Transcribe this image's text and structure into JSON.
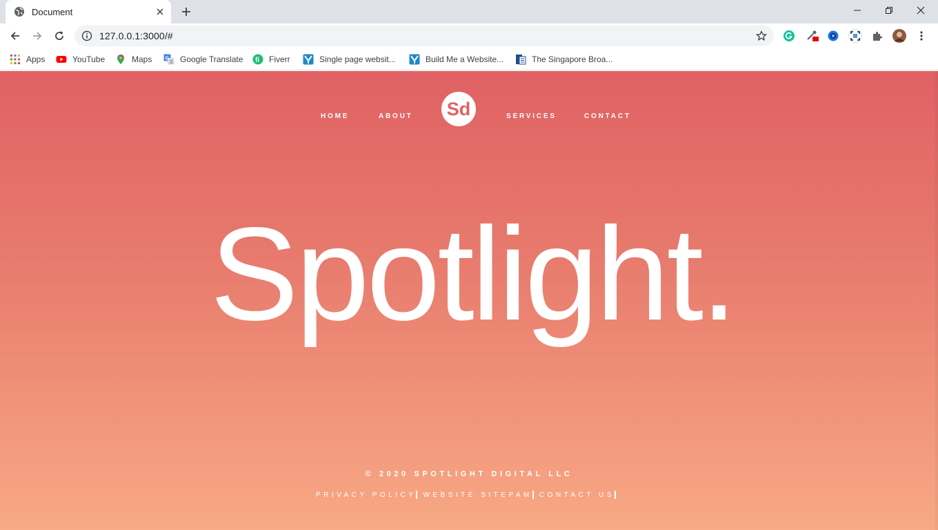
{
  "browser": {
    "tab_title": "Document",
    "url": "127.0.0.1:3000/#",
    "tab_close_icon": "close-icon",
    "new_tab_icon": "plus-icon"
  },
  "bookmarks": [
    {
      "label": "Apps",
      "icon": "apps-grid-icon"
    },
    {
      "label": "YouTube",
      "icon": "youtube-icon"
    },
    {
      "label": "Maps",
      "icon": "maps-pin-icon"
    },
    {
      "label": "Google Translate",
      "icon": "translate-icon"
    },
    {
      "label": "Fiverr",
      "icon": "fiverr-icon"
    },
    {
      "label": "Single page websit...",
      "icon": "yoast-icon"
    },
    {
      "label": "Build Me a Website...",
      "icon": "yoast-icon"
    },
    {
      "label": "The Singapore Broa...",
      "icon": "document-icon"
    }
  ],
  "site": {
    "nav": {
      "home": "HOME",
      "about": "ABOUT",
      "logo": "Sd",
      "services": "SERVICES",
      "contact": "CONTACT"
    },
    "hero_title": "Spotlight.",
    "copyright": "© 2020 SPOTLIGHT DIGITAL LLC",
    "footer_links": {
      "privacy": "PRIVACY POLICY",
      "sitemap": "WEBSITE SITEPAM",
      "contact": "CONTACT US"
    }
  },
  "colors": {
    "accent": "#e06164",
    "gradient_top": "#e06164",
    "gradient_bottom": "#f8a985"
  }
}
